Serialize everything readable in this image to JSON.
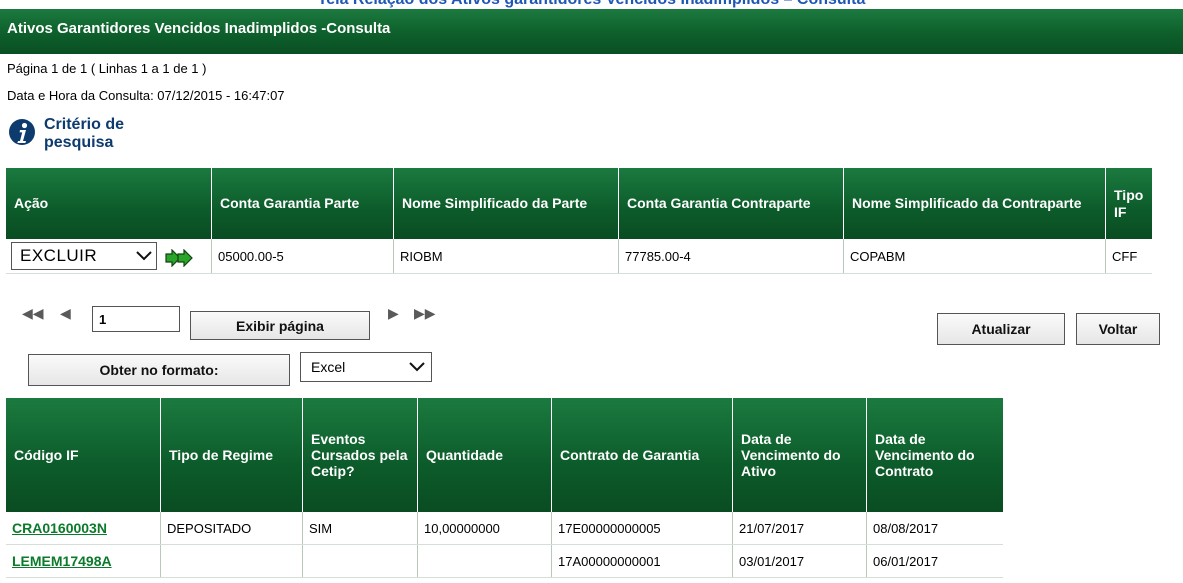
{
  "top_title_clipped": "Tela Relação dos Ativos garantidores Vencidos Inadimplidos – Consulta",
  "header": {
    "title": "Ativos Garantidores Vencidos Inadimplidos -Consulta"
  },
  "info": {
    "page_line": "Página 1 de 1 ( Linhas 1 a 1 de 1 )",
    "datetime_line": "Data e Hora da Consulta: 07/12/2015 - 16:47:07"
  },
  "criteria": {
    "line1": "Critério de",
    "line2": "pesquisa"
  },
  "grid_a": {
    "headers": [
      "Ação",
      "Conta Garantia Parte",
      "Nome Simplificado da Parte",
      "Conta Garantia Contraparte",
      "Nome Simplificado da Contraparte",
      "Tipo IF"
    ],
    "row": {
      "action_value": "EXCLUIR",
      "conta_parte": "05000.00-5",
      "nome_parte": "RIOBM",
      "conta_contraparte": "77785.00-4",
      "nome_contraparte": "COPABM",
      "tipo_if": "CFF"
    }
  },
  "pager": {
    "page_value": "1",
    "show_page_label": "Exibir página"
  },
  "buttons": {
    "refresh": "Atualizar",
    "back": "Voltar",
    "export": "Obter no formato:"
  },
  "format_select": {
    "value": "Excel"
  },
  "grid_b": {
    "headers": [
      "Código IF",
      "Tipo de Regime",
      "Eventos Cursados pela Cetip?",
      "Quantidade",
      "Contrato de Garantia",
      "Data de Vencimento do Ativo",
      "Data de Vencimento do Contrato"
    ],
    "rows": [
      [
        "CRA0160003N",
        "DEPOSITADO",
        "SIM",
        "10,00000000",
        "17E00000000005",
        "21/07/2017",
        "08/08/2017"
      ],
      [
        "LEMEM17498A",
        "",
        "",
        "",
        "17A00000000001",
        "03/01/2017",
        "06/01/2017"
      ]
    ]
  },
  "colors": {
    "header_green": "#0d5f2b",
    "link_green": "#0b7a2a",
    "title_blue": "#1f57b5",
    "criteria_blue": "#0d3b6e"
  }
}
